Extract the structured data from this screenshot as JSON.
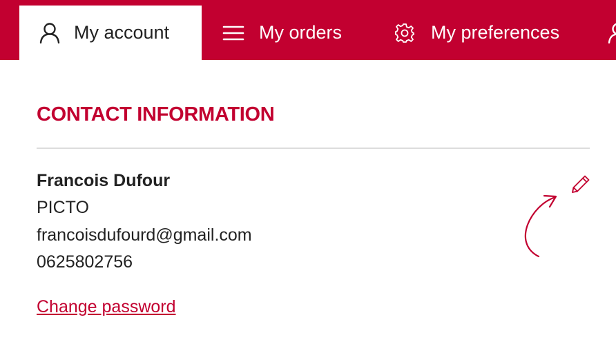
{
  "tabs": {
    "account": {
      "label": "My account",
      "icon": "user-icon",
      "active": true
    },
    "orders": {
      "label": "My orders",
      "icon": "menu-icon",
      "active": false
    },
    "preferences": {
      "label": "My preferences",
      "icon": "gear-icon",
      "active": false
    },
    "extra": {
      "label": "",
      "icon": "user-icon",
      "active": false
    }
  },
  "contact": {
    "section_title": "CONTACT INFORMATION",
    "name": "Francois Dufour",
    "company": "PICTO",
    "email": "francoisdufourd@gmail.com",
    "phone": "0625802756",
    "edit_icon": "pencil-icon"
  },
  "links": {
    "change_password": "Change password"
  },
  "colors": {
    "brand": "#c20030",
    "text": "#222222",
    "divider": "#dcdcdc",
    "background": "#ffffff"
  }
}
